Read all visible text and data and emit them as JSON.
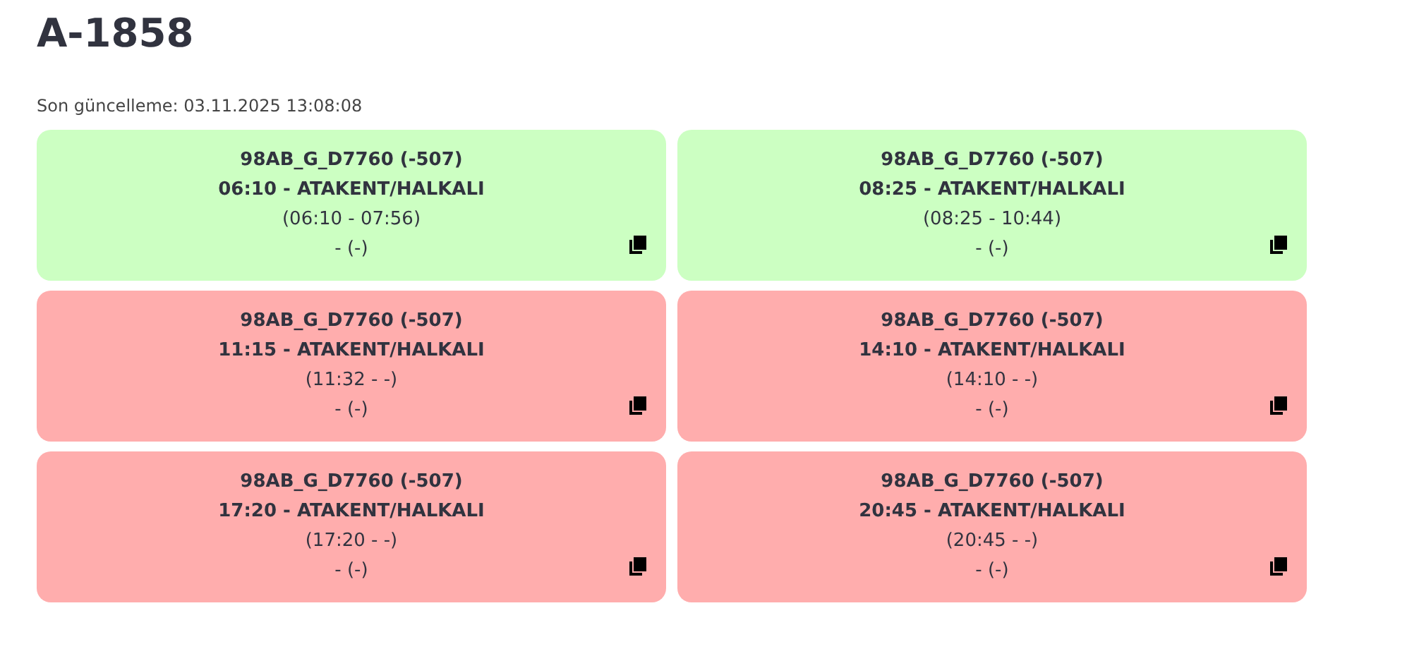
{
  "title": "A-1858",
  "updated": "Son güncelleme: 03.11.2025 13:08:08",
  "trips": [
    {
      "color": "#ccffc2",
      "vehicle": "98AB_G_D7760 (-507)",
      "route": "06:10 - ATAKENT/HALKALI",
      "times": "(06:10 - 07:56)",
      "note": "- (-)"
    },
    {
      "color": "#ccffc2",
      "vehicle": "98AB_G_D7760 (-507)",
      "route": "08:25 - ATAKENT/HALKALI",
      "times": "(08:25 - 10:44)",
      "note": "- (-)"
    },
    {
      "color": "#ffadad",
      "vehicle": "98AB_G_D7760 (-507)",
      "route": "11:15 - ATAKENT/HALKALI",
      "times": "(11:32 - -)",
      "note": "- (-)"
    },
    {
      "color": "#ffadad",
      "vehicle": "98AB_G_D7760 (-507)",
      "route": "14:10 - ATAKENT/HALKALI",
      "times": "(14:10 - -)",
      "note": "- (-)"
    },
    {
      "color": "#ffadad",
      "vehicle": "98AB_G_D7760 (-507)",
      "route": "17:20 - ATAKENT/HALKALI",
      "times": "(17:20 - -)",
      "note": "- (-)"
    },
    {
      "color": "#ffadad",
      "vehicle": "98AB_G_D7760 (-507)",
      "route": "20:45 - ATAKENT/HALKALI",
      "times": "(20:45 - -)",
      "note": "- (-)"
    }
  ]
}
